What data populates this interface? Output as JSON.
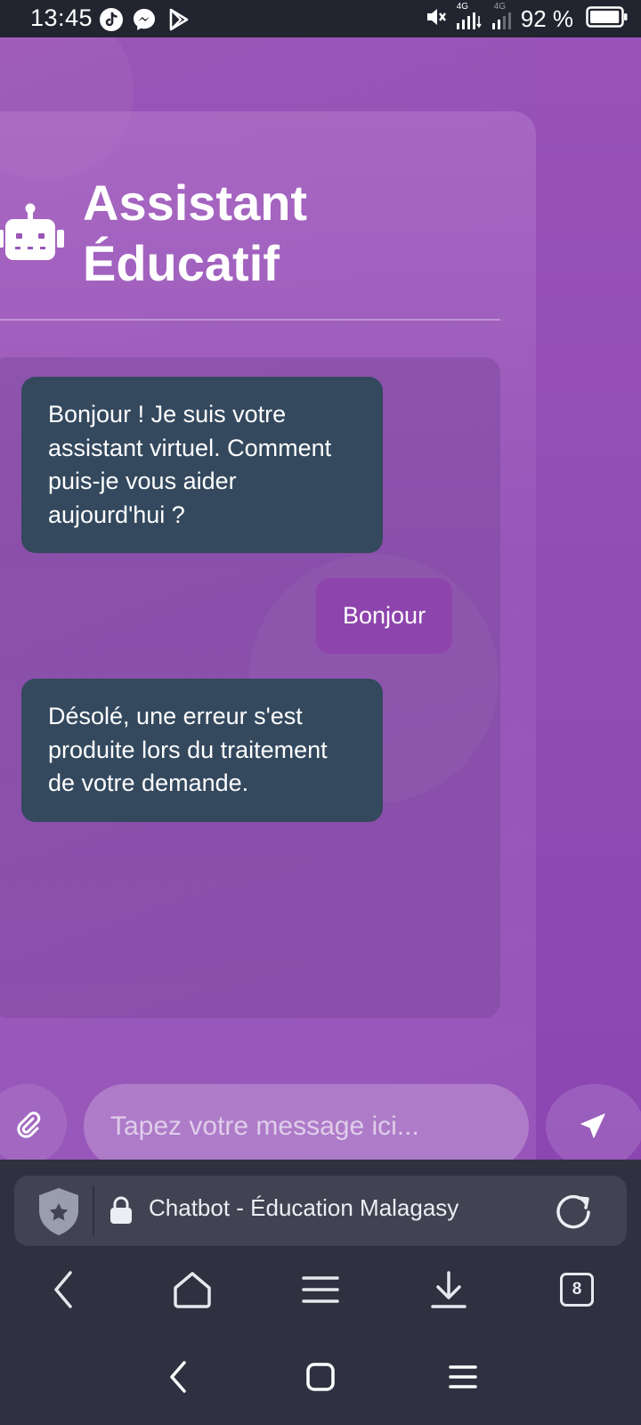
{
  "status_bar": {
    "time": "13:45",
    "notification_icons": [
      "tiktok-icon",
      "messenger-icon",
      "play-store-icon"
    ],
    "network_label_1": "4G",
    "network_label_2": "4G",
    "battery_percent": "92 %",
    "battery_level": 0.92
  },
  "chat": {
    "title_line1": "Assistant",
    "title_line2": "Éducatif",
    "title_icon": "robot-icon",
    "messages": [
      {
        "sender": "bot",
        "text": "Bonjour ! Je suis votre assistant virtuel. Comment puis-je vous aider aujourd'hui ?"
      },
      {
        "sender": "user",
        "text": "Bonjour"
      },
      {
        "sender": "bot",
        "text": "Désolé, une erreur s'est produite lors du traitement de votre demande."
      }
    ],
    "input_placeholder": "Tapez votre message ici...",
    "input_value": "",
    "attach_icon": "paperclip-icon",
    "send_icon": "send-icon"
  },
  "browser": {
    "tab_title": "Chatbot - Éducation Malagasy",
    "tabs_count": "8",
    "nav_icons": [
      "back-icon",
      "home-icon",
      "menu-icon",
      "download-icon",
      "tabs-icon"
    ]
  },
  "colors": {
    "page_bg": "#9150b4",
    "bot_bubble": "#34495e",
    "user_bubble": "#8e44ad",
    "browser_chrome": "#2f3140",
    "status_bar": "#22242f"
  }
}
